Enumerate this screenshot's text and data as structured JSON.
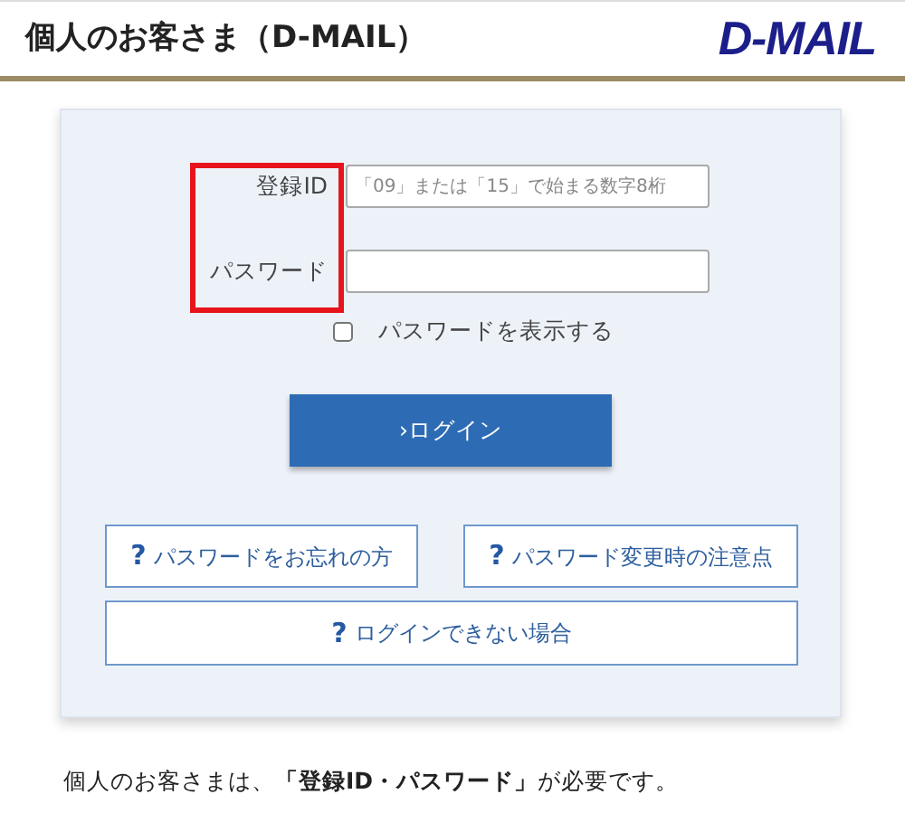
{
  "header": {
    "title": "個人のお客さま（D-MAIL）",
    "logo": "D-MAIL"
  },
  "form": {
    "labels_highlighted": true,
    "fields": [
      {
        "label": "登録ID",
        "placeholder": "「09」または「15」で始まる数字8桁"
      },
      {
        "label": "パスワード"
      }
    ],
    "show_password": {
      "label": "パスワードを表示する",
      "checked": false
    },
    "login_button": "›ログイン",
    "help_links": [
      {
        "icon": "?",
        "label": "パスワードをお忘れの方"
      },
      {
        "icon": "?",
        "label": "パスワード変更時の注意点"
      },
      {
        "icon": "?",
        "label": "ログインできない場合"
      }
    ]
  },
  "note": "個人のお客さまは、**「登録ID・パスワード」**が必要です。"
}
